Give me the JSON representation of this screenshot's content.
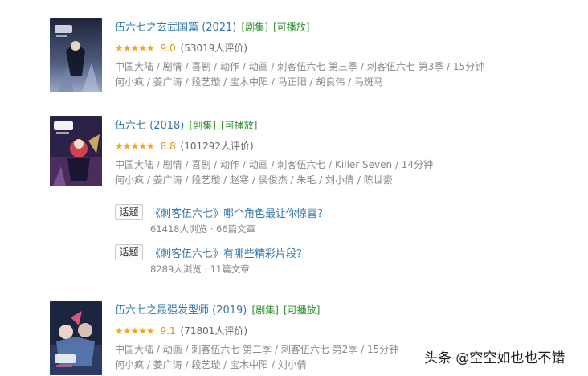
{
  "items": [
    {
      "title": "伍六七之玄武国篇 (2021)",
      "tags": [
        "[剧集]",
        "[可播放]"
      ],
      "stars": "★★★★★",
      "score": "9.0",
      "count": "(53019人评价)",
      "meta": "中国大陆 / 剧情 / 喜剧 / 动作 / 动画 / 刺客伍六七 第三季 / 刺客伍六七 第3季 / 15分钟",
      "cast": "何小疯 / 姜广涛 / 段艺璇 / 宝木中阳 / 马正阳 / 胡良伟 / 马斑马",
      "poster_colors": [
        "#2b3550",
        "#6f7fa6",
        "#c7d2e8"
      ]
    },
    {
      "title": "伍六七 (2018)",
      "tags": [
        "[剧集]",
        "[可播放]"
      ],
      "stars": "★★★★★",
      "score": "8.8",
      "count": "(101292人评价)",
      "meta": "中国大陆 / 剧情 / 喜剧 / 动作 / 动画 / 刺客伍六七 / Killer Seven / 14分钟",
      "cast": "何小疯 / 姜广涛 / 段艺璇 / 赵寒 / 侯俊杰 / 朱毛 / 刘小倩 / 陈世豪",
      "poster_colors": [
        "#3a2a5a",
        "#d2414e",
        "#f0c86a"
      ]
    },
    {
      "title": "伍六七之最强发型师 (2019)",
      "tags": [
        "[剧集]",
        "[可播放]"
      ],
      "stars": "★★★★★",
      "score": "9.1",
      "count": "(71801人评价)",
      "meta": "中国大陆 / 动画 / 刺客伍六七 第二季 / 刺客伍六七 第2季 / 15分钟",
      "cast": "何小疯 / 姜广涛 / 段艺璇 / 宝木中阳 / 刘小倩",
      "poster_colors": [
        "#1f2a44",
        "#5e7fb8",
        "#d65a7a"
      ]
    }
  ],
  "topics": [
    {
      "badge": "话题",
      "title": "《刺客伍六七》哪个角色最让你惊喜？",
      "sub": "61418人浏览 · 66篇文章"
    },
    {
      "badge": "话题",
      "title": "《刺客伍六七》有哪些精彩片段？",
      "sub": "8289人浏览 · 11篇文章"
    }
  ],
  "watermark": "头条 @空空如也也不错"
}
